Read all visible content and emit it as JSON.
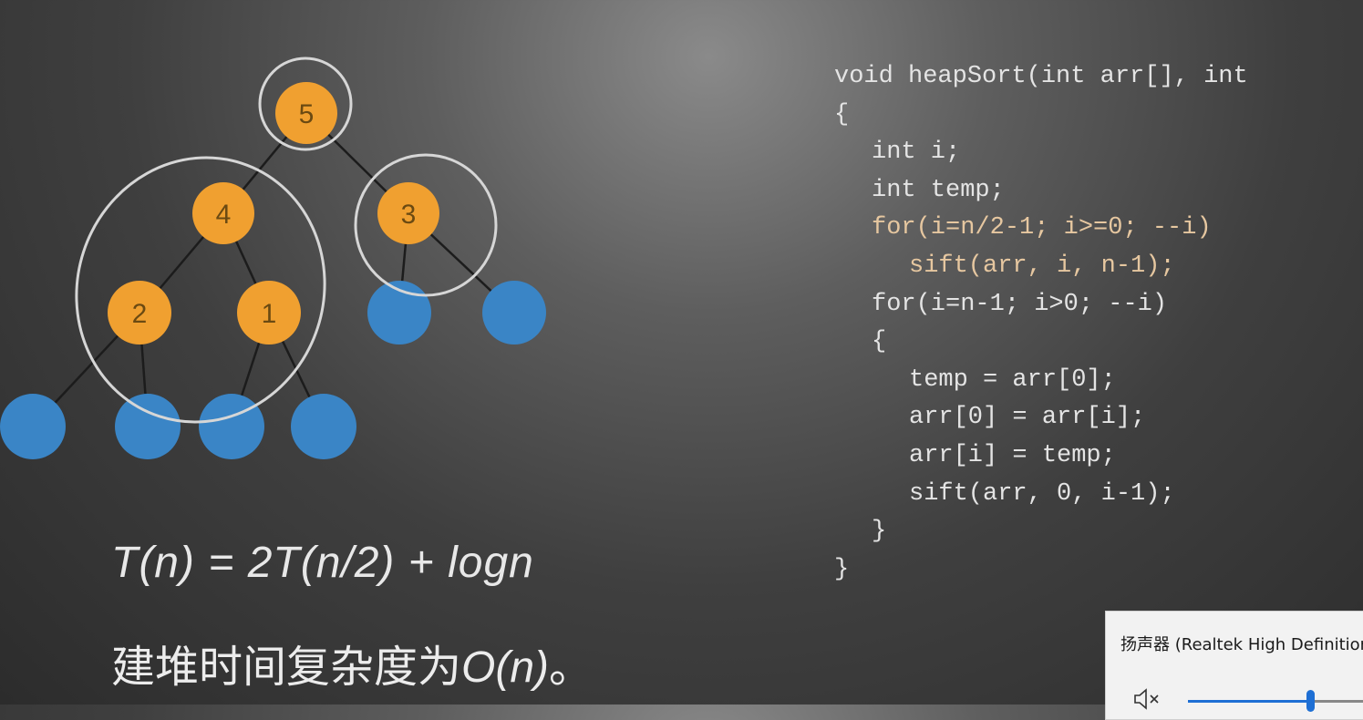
{
  "tree": {
    "nodes": [
      {
        "id": "n5",
        "label": "5",
        "color": "#f0a030"
      },
      {
        "id": "n4",
        "label": "4",
        "color": "#f0a030"
      },
      {
        "id": "n3",
        "label": "3",
        "color": "#f0a030"
      },
      {
        "id": "n2",
        "label": "2",
        "color": "#f0a030"
      },
      {
        "id": "n1",
        "label": "1",
        "color": "#f0a030"
      },
      {
        "id": "b1",
        "label": "",
        "color": "#3a85c6"
      },
      {
        "id": "b2",
        "label": "",
        "color": "#3a85c6"
      },
      {
        "id": "b3",
        "label": "",
        "color": "#3a85c6"
      },
      {
        "id": "b4",
        "label": "",
        "color": "#3a85c6"
      },
      {
        "id": "b5",
        "label": "",
        "color": "#3a85c6"
      },
      {
        "id": "b6",
        "label": "",
        "color": "#3a85c6"
      }
    ]
  },
  "code": {
    "lines": [
      "void heapSort(int arr[], int",
      "{",
      "int i;",
      "int temp;",
      "for(i=n/2-1; i>=0; --i)",
      "sift(arr, i, n-1);",
      "for(i=n-1; i>0; --i)",
      "{",
      "temp = arr[0];",
      "arr[0] = arr[i];",
      "arr[i] = temp;",
      "sift(arr, 0, i-1);",
      "}",
      "}"
    ]
  },
  "formula": "T(n) = 2T(n/2) + logn",
  "note": {
    "prefix": "建堆时间复杂度为",
    "expr": "O(n)",
    "suffix": "。"
  },
  "volume_flyout": {
    "device_name": "扬声器 (Realtek High Definition Audio)",
    "level": 0.67,
    "icon": "speaker-muted-icon"
  },
  "colors": {
    "orange_node": "#f0a030",
    "blue_node": "#3a85c6",
    "code_text": "#e4e4e4",
    "volume_accent": "#1e6fd4"
  }
}
